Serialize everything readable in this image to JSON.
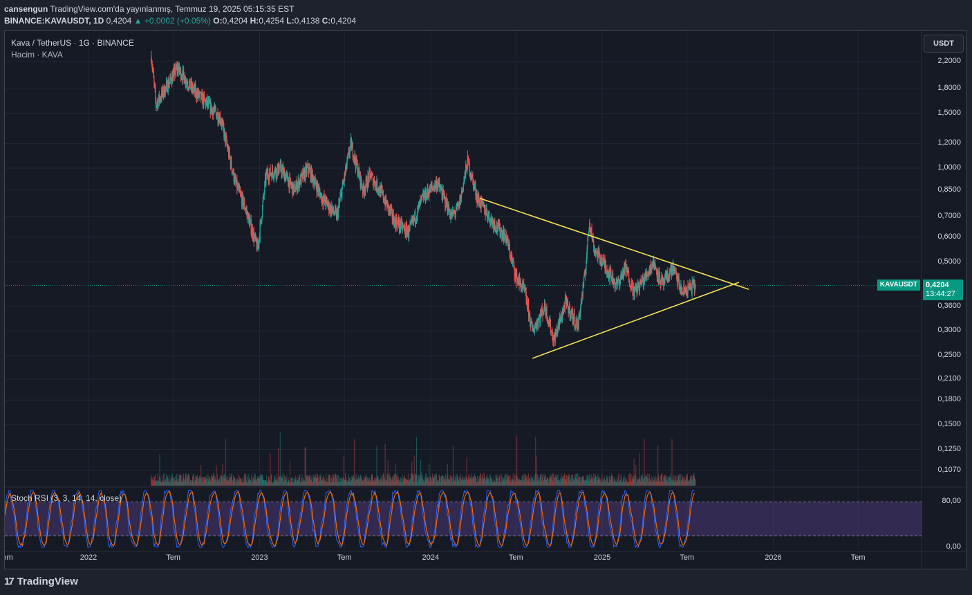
{
  "header": {
    "user": "cansengun",
    "published": "TradingView.com'da yayınlanmış, Temmuz 19, 2025 05:15:35 EST",
    "symbol_line": "BINANCE:KAVAUSDT, 1D",
    "last": "0,4204",
    "change": "▲ +0,0002 (+0.05%)",
    "o_label": "O:",
    "o_value": "0,4204",
    "h_label": "H:",
    "h_value": "0,4254",
    "l_label": "L:",
    "l_value": "0,4138",
    "c_label": "C:",
    "c_value": "0,4204"
  },
  "legend": {
    "title": "Kava / TetherUS · 1G · BINANCE",
    "volume": "Hacim · KAVA",
    "rsi": "Stoch RSI (3, 3, 14, 14, close)"
  },
  "currency_button": "USDT",
  "price_tag": {
    "symbol": "KAVAUSDT",
    "price": "0,4204",
    "countdown": "13:44:27"
  },
  "brand": {
    "logo": "17",
    "name": "TradingView"
  },
  "colors": {
    "up": "#26a69a",
    "down": "#ef5350",
    "trendline": "#f3e255",
    "rsi_k": "#2962ff",
    "rsi_d": "#ff6d00",
    "rsi_band": "#7e57c2",
    "background": "#161a25"
  },
  "chart_data": [
    {
      "type": "candlestick",
      "title": "Kava / TetherUS · 1G · BINANCE",
      "scale": "log",
      "ylim": [
        0.1,
        2.6
      ],
      "y_ticks": [
        "2,2000",
        "1,8000",
        "1,5000",
        "1,2000",
        "1,0000",
        "0,8500",
        "0,7000",
        "0,6000",
        "0,5000",
        "0,3600",
        "0,3000",
        "0,2500",
        "0,2100",
        "0,1800",
        "0,1500",
        "0,1250",
        "0,1070"
      ],
      "y_tick_values": [
        2.2,
        1.8,
        1.5,
        1.2,
        1.0,
        0.85,
        0.7,
        0.6,
        0.5,
        0.36,
        0.3,
        0.25,
        0.21,
        0.18,
        0.15,
        0.125,
        0.107
      ],
      "x_ticks": [
        "em",
        "2022",
        "Tem",
        "2023",
        "Tem",
        "2024",
        "Tem",
        "2025",
        "Tem",
        "2026",
        "Tem"
      ],
      "x_tick_dates": [
        "2021-07-01",
        "2022-01-01",
        "2022-07-01",
        "2023-01-01",
        "2023-07-01",
        "2024-01-01",
        "2024-07-01",
        "2025-01-01",
        "2025-07-01",
        "2026-01-01",
        "2026-07-01"
      ],
      "last_price": 0.4204,
      "close_path": [
        {
          "date": "2022-05-15",
          "close": 2.3
        },
        {
          "date": "2022-05-25",
          "close": 1.6
        },
        {
          "date": "2022-07-10",
          "close": 2.1
        },
        {
          "date": "2022-08-10",
          "close": 1.8
        },
        {
          "date": "2022-10-10",
          "close": 1.45
        },
        {
          "date": "2022-11-10",
          "close": 0.9
        },
        {
          "date": "2022-12-01",
          "close": 0.75
        },
        {
          "date": "2022-12-28",
          "close": 0.55
        },
        {
          "date": "2023-01-15",
          "close": 0.95
        },
        {
          "date": "2023-02-15",
          "close": 1.0
        },
        {
          "date": "2023-03-15",
          "close": 0.85
        },
        {
          "date": "2023-04-15",
          "close": 1.0
        },
        {
          "date": "2023-05-15",
          "close": 0.8
        },
        {
          "date": "2023-06-15",
          "close": 0.7
        },
        {
          "date": "2023-07-15",
          "close": 1.2
        },
        {
          "date": "2023-08-10",
          "close": 0.85
        },
        {
          "date": "2023-08-25",
          "close": 0.95
        },
        {
          "date": "2023-09-15",
          "close": 0.85
        },
        {
          "date": "2023-10-15",
          "close": 0.68
        },
        {
          "date": "2023-11-15",
          "close": 0.62
        },
        {
          "date": "2023-12-15",
          "close": 0.8
        },
        {
          "date": "2024-01-15",
          "close": 0.9
        },
        {
          "date": "2024-02-15",
          "close": 0.7
        },
        {
          "date": "2024-03-01",
          "close": 0.75
        },
        {
          "date": "2024-03-20",
          "close": 1.05
        },
        {
          "date": "2024-04-10",
          "close": 0.8
        },
        {
          "date": "2024-05-10",
          "close": 0.68
        },
        {
          "date": "2024-06-10",
          "close": 0.6
        },
        {
          "date": "2024-07-01",
          "close": 0.45
        },
        {
          "date": "2024-07-20",
          "close": 0.4
        },
        {
          "date": "2024-08-05",
          "close": 0.3
        },
        {
          "date": "2024-09-01",
          "close": 0.36
        },
        {
          "date": "2024-09-20",
          "close": 0.28
        },
        {
          "date": "2024-10-15",
          "close": 0.37
        },
        {
          "date": "2024-11-10",
          "close": 0.31
        },
        {
          "date": "2024-11-25",
          "close": 0.45
        },
        {
          "date": "2024-12-05",
          "close": 0.68
        },
        {
          "date": "2024-12-15",
          "close": 0.55
        },
        {
          "date": "2025-01-10",
          "close": 0.48
        },
        {
          "date": "2025-02-01",
          "close": 0.42
        },
        {
          "date": "2025-02-20",
          "close": 0.48
        },
        {
          "date": "2025-03-10",
          "close": 0.4
        },
        {
          "date": "2025-04-01",
          "close": 0.44
        },
        {
          "date": "2025-04-20",
          "close": 0.5
        },
        {
          "date": "2025-05-10",
          "close": 0.42
        },
        {
          "date": "2025-06-01",
          "close": 0.48
        },
        {
          "date": "2025-06-20",
          "close": 0.4
        },
        {
          "date": "2025-07-19",
          "close": 0.4204
        }
      ],
      "trendlines": [
        {
          "label": "descending resistance",
          "from": {
            "date": "2024-04-15",
            "price": 0.8
          },
          "to": {
            "date": "2025-11-10",
            "price": 0.408
          }
        },
        {
          "label": "ascending support",
          "from": {
            "date": "2024-08-05",
            "price": 0.245
          },
          "to": {
            "date": "2025-10-20",
            "price": 0.43
          }
        }
      ]
    },
    {
      "type": "bar",
      "title": "Hacim · KAVA",
      "note": "daily volume histogram along the bottom of the price pane"
    },
    {
      "type": "line",
      "title": "Stoch RSI (3, 3, 14, 14, close)",
      "ylim": [
        0,
        100
      ],
      "y_ticks": [
        "80,00",
        "0,00"
      ],
      "bands": [
        20,
        80
      ],
      "series": [
        {
          "name": "K"
        },
        {
          "name": "D"
        }
      ]
    }
  ]
}
